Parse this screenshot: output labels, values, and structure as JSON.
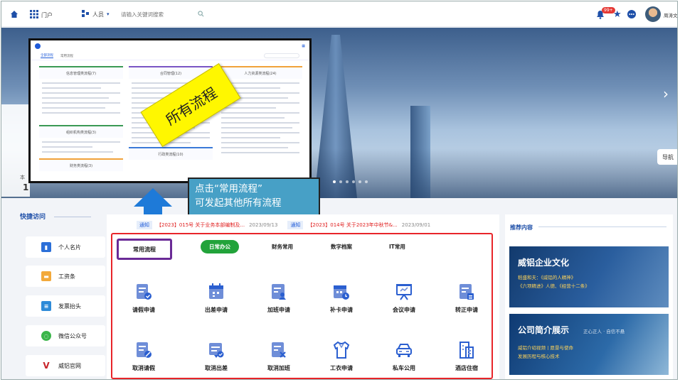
{
  "topbar": {
    "portal_label": "门户",
    "scope_select": "人员",
    "search_placeholder": "请输入关键词搜索",
    "notif_badge": "99+",
    "user_name": "周涛文"
  },
  "banner": {
    "nav_button": "导航",
    "left_char": "本",
    "left_digit": "1"
  },
  "popup": {
    "tabs": [
      "全部流程",
      "常用流程"
    ],
    "columns": [
      {
        "title": "信息管理类流程(7)",
        "color": "#3a9a54"
      },
      {
        "title": "合同管理(12)",
        "color": "#7a55c4"
      },
      {
        "title": "人力资源类流程(24)",
        "color": "#f1a23a"
      }
    ],
    "lower_columns": [
      {
        "title": "组织机构类流程(3)",
        "color": "#3a9a54"
      },
      {
        "title": "行政类流程(10)",
        "color": "#3a7ad8"
      },
      {
        "title": "财务类流程(3)",
        "color": "#f1a23a"
      }
    ],
    "sticky_note": "所有流程"
  },
  "callout": {
    "line1": "点击“常用流程”",
    "line2": "可发起其他所有流程"
  },
  "quick_access": {
    "title": "快捷访问",
    "items": [
      {
        "label": "个人名片",
        "color": "#2b6fd8"
      },
      {
        "label": "工资条",
        "color": "#f2a93b"
      },
      {
        "label": "发票抬头",
        "color": "#2f8bd8"
      },
      {
        "label": "微信公众号",
        "color": "#3bb54a"
      },
      {
        "label": "威铝官网",
        "color": "#c8242a"
      }
    ]
  },
  "notices": [
    {
      "tag": "通知",
      "text": "【2023】015号 关于业务本部编制及...",
      "date": "2023/09/13"
    },
    {
      "tag": "通知",
      "text": "【2023】014号 关于2023年中秋节&...",
      "date": "2023/09/01"
    }
  ],
  "process_tabs": {
    "common": "常用流程",
    "tabs": [
      "日常办公",
      "财务常用",
      "数字档案",
      "IT常用"
    ]
  },
  "processes": [
    {
      "label": "请假申请",
      "icon": "form-check-icon"
    },
    {
      "label": "出差申请",
      "icon": "calendar-icon"
    },
    {
      "label": "加班申请",
      "icon": "form-person-icon"
    },
    {
      "label": "补卡申请",
      "icon": "calendar-clock-icon"
    },
    {
      "label": "会议申请",
      "icon": "presentation-icon"
    },
    {
      "label": "转正申请",
      "icon": "form-stamp-icon"
    },
    {
      "label": "取消请假",
      "icon": "form-cancel-icon"
    },
    {
      "label": "取消出差",
      "icon": "briefcase-cancel-icon"
    },
    {
      "label": "取消加班",
      "icon": "form-x-icon"
    },
    {
      "label": "工衣申请",
      "icon": "shirt-icon"
    },
    {
      "label": "私车公用",
      "icon": "car-icon"
    },
    {
      "label": "酒店住宿",
      "icon": "hotel-icon"
    }
  ],
  "recommended": {
    "title": "推荐内容",
    "card1": {
      "title": "威铝企业文化",
      "line1": "稻盛和夫：《威铝的人精神》",
      "line2": "《六项精进》人德、《经营十二条》"
    },
    "card2": {
      "title": "公司简介展示",
      "tagline": "正心正人 · 自信不悬",
      "line1": "威铝介绍视频丨愿景与使命",
      "line2": "发展历程与核心技术"
    }
  },
  "colors": {
    "accent": "#1e5ad8",
    "active_tab": "#22a33a",
    "highlight_red": "#e8252a",
    "highlight_purple": "#6a2a96",
    "callout": "#47a0c6",
    "sticky": "#fff700"
  }
}
